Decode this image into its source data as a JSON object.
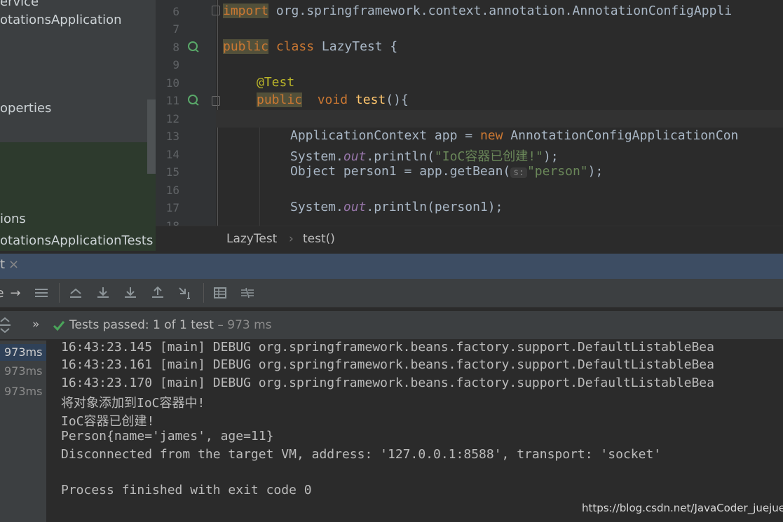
{
  "project_tree": {
    "items": [
      {
        "text": "ervice"
      },
      {
        "text": "otationsApplication"
      },
      {
        "text": "operties"
      },
      {
        "text": "ions"
      },
      {
        "text": "otationsApplicationTests"
      }
    ]
  },
  "editor": {
    "line_numbers": [
      "6",
      "7",
      "8",
      "9",
      "10",
      "11",
      "12",
      "13",
      "14",
      "15",
      "16",
      "17",
      "18"
    ],
    "code": {
      "l6_kw": "import",
      "l6_rest": " org.springframework.context.annotation.AnnotationConfigAppli",
      "l8_kw1": "public",
      "l8_kw2": "class",
      "l8_rest": " LazyTest {",
      "l10_ann": "@Test",
      "l11_kw1": "public",
      "l11_kw2": "void",
      "l11_fn": "test",
      "l11_rest": "(){",
      "l13_a": "ApplicationContext app = ",
      "l13_kw": "new",
      "l13_b": " AnnotationConfigApplicationCon",
      "l14_a": "System.",
      "l14_out": "out",
      "l14_b": ".println(",
      "l14_str": "\"IoC容器已创建!\"",
      "l14_c": ");",
      "l15_a": "Object person1 = app.getBean(",
      "l15_hint": "s:",
      "l15_str": "\"person\"",
      "l15_c": ");",
      "l17_a": "System.",
      "l17_out": "out",
      "l17_b": ".println(person1);"
    }
  },
  "breadcrumb": {
    "class": "LazyTest",
    "separator": "›",
    "method": "test()"
  },
  "run_tab": {
    "title": "t",
    "close": "×"
  },
  "toolbar": {
    "labels": [
      "e",
      "→"
    ]
  },
  "status": {
    "passed": "Tests passed:",
    "count": "1 of 1 test",
    "time": "– 973 ms",
    "expand": "»"
  },
  "timings": [
    "973ms",
    "973ms",
    "973ms"
  ],
  "console": {
    "lines": [
      "16:43:23.145 [main] DEBUG org.springframework.beans.factory.support.DefaultListableBea",
      "16:43:23.161 [main] DEBUG org.springframework.beans.factory.support.DefaultListableBea",
      "16:43:23.170 [main] DEBUG org.springframework.beans.factory.support.DefaultListableBea",
      "将对象添加到IoC容器中!",
      "IoC容器已创建!",
      "Person{name='james', age=11}",
      "Disconnected from the target VM, address: '127.0.0.1:8588', transport: 'socket'",
      "",
      "Process finished with exit code 0"
    ]
  },
  "watermark": "https://blog.csdn.net/JavaCoder_juejue",
  "colors": {
    "keyword": "#cc7832",
    "annotation": "#bbb529",
    "string": "#6a8759",
    "success": "#4aa55a",
    "selection": "#2f4158"
  }
}
